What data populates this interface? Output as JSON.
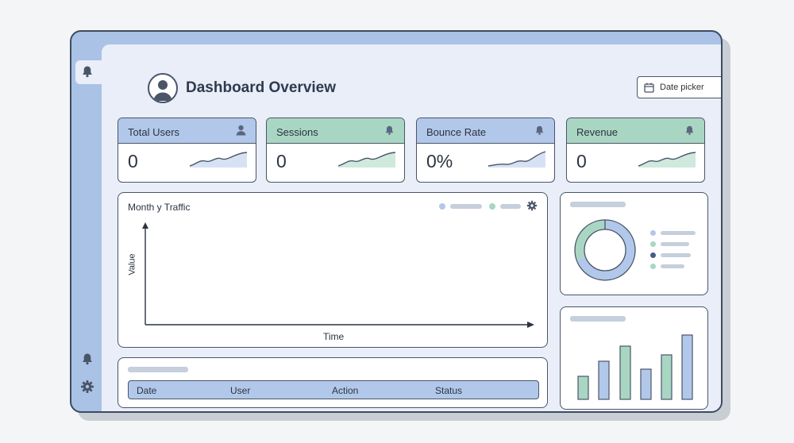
{
  "header": {
    "title": "Dashboard Overview"
  },
  "date_picker": {
    "label": "Date picker"
  },
  "stats": [
    {
      "label": "Total Users",
      "value": "0",
      "icon": "user-icon",
      "accent": "blue"
    },
    {
      "label": "Sessions",
      "value": "0",
      "icon": "bell-icon",
      "accent": "green"
    },
    {
      "label": "Bounce Rate",
      "value": "0%",
      "icon": "bell-icon",
      "accent": "blue"
    },
    {
      "label": "Revenue",
      "value": "0",
      "icon": "bell-icon",
      "accent": "green"
    }
  ],
  "traffic_chart": {
    "title": "Month y Traffic",
    "ylabel": "Value",
    "xlabel": "Time"
  },
  "table": {
    "columns": [
      "Date",
      "User",
      "Action",
      "Status"
    ]
  },
  "sidebar": {
    "icons": [
      "bell-icon",
      "bell-icon",
      "gear-icon"
    ]
  },
  "colors": {
    "frame": "#a9c2e6",
    "accent_blue": "#b2c8ea",
    "accent_green": "#a9d6c3",
    "outline": "#4a5568",
    "background": "#e9eef8"
  }
}
